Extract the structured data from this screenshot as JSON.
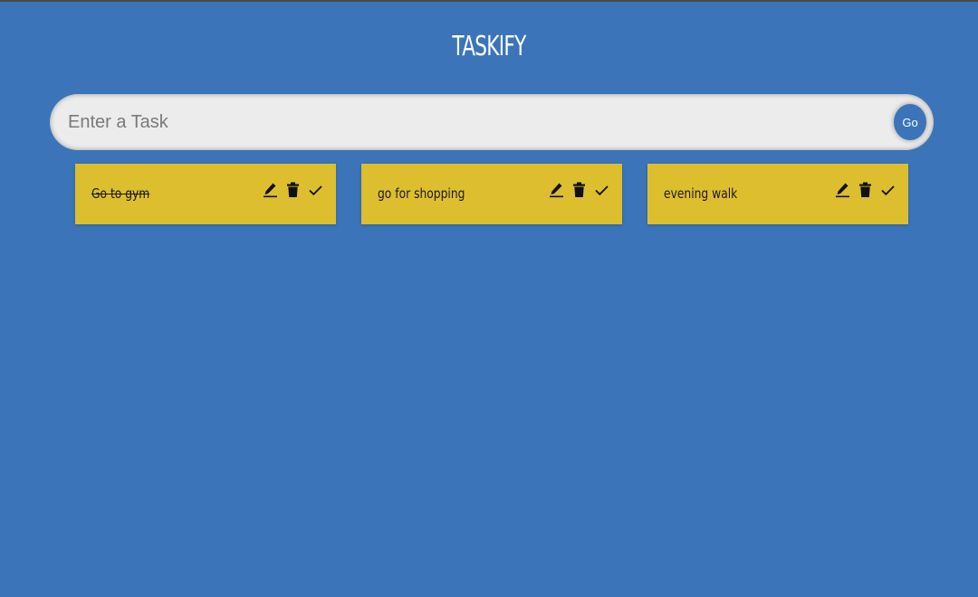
{
  "app": {
    "title": "TASKIFY"
  },
  "input": {
    "placeholder": "Enter a Task",
    "value": "",
    "go_label": "Go"
  },
  "tasks": [
    {
      "text": "Go to gym",
      "done": true
    },
    {
      "text": "go for shopping",
      "done": false
    },
    {
      "text": "evening walk",
      "done": false
    }
  ],
  "icons": {
    "edit": "pencil-icon",
    "delete": "trash-icon",
    "complete": "check-icon"
  },
  "colors": {
    "background": "#3b74b9",
    "card": "#dcbe2f",
    "input": "#ececec"
  }
}
